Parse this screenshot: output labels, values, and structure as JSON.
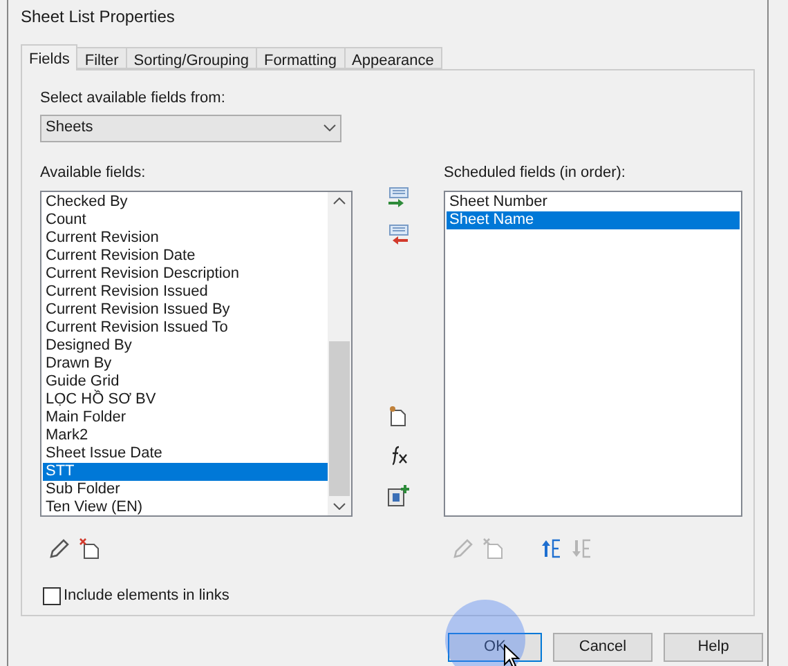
{
  "window": {
    "title": "Sheet List Properties"
  },
  "tabs": [
    {
      "label": "Fields",
      "selected": true
    },
    {
      "label": "Filter",
      "selected": false
    },
    {
      "label": "Sorting/Grouping",
      "selected": false
    },
    {
      "label": "Formatting",
      "selected": false
    },
    {
      "label": "Appearance",
      "selected": false
    }
  ],
  "source_label": "Select available fields from:",
  "source": {
    "value": "Sheets"
  },
  "available_label": "Available fields:",
  "available_fields": [
    {
      "label": "Checked By",
      "selected": false
    },
    {
      "label": "Count",
      "selected": false
    },
    {
      "label": "Current Revision",
      "selected": false
    },
    {
      "label": "Current Revision Date",
      "selected": false
    },
    {
      "label": "Current Revision Description",
      "selected": false
    },
    {
      "label": "Current Revision Issued",
      "selected": false
    },
    {
      "label": "Current Revision Issued By",
      "selected": false
    },
    {
      "label": "Current Revision Issued To",
      "selected": false
    },
    {
      "label": "Designed By",
      "selected": false
    },
    {
      "label": "Drawn By",
      "selected": false
    },
    {
      "label": "Guide Grid",
      "selected": false
    },
    {
      "label": "LỌC HỒ SƠ BV",
      "selected": false
    },
    {
      "label": "Main Folder",
      "selected": false
    },
    {
      "label": "Mark2",
      "selected": false
    },
    {
      "label": "Sheet Issue Date",
      "selected": false
    },
    {
      "label": "STT",
      "selected": true
    },
    {
      "label": "Sub Folder",
      "selected": false
    },
    {
      "label": "Ten View (EN)",
      "selected": false
    }
  ],
  "middle_actions": [
    {
      "kind": "add"
    },
    {
      "kind": "remove"
    },
    {
      "kind": "parameter"
    },
    {
      "kind": "formula"
    },
    {
      "kind": "combine"
    }
  ],
  "scheduled_label": "Scheduled fields (in order):",
  "scheduled_fields": [
    {
      "label": "Sheet Number",
      "selected": false
    },
    {
      "label": "Sheet Name",
      "selected": true
    }
  ],
  "available_actions": [
    {
      "kind": "edit",
      "disabled": false
    },
    {
      "kind": "delete",
      "disabled": false
    }
  ],
  "scheduled_actions": [
    {
      "kind": "edit",
      "disabled": true
    },
    {
      "kind": "delete",
      "disabled": true
    },
    {
      "kind": "move_up",
      "disabled": false
    },
    {
      "kind": "move_down",
      "disabled": true
    }
  ],
  "include_links": {
    "label": "Include elements in links",
    "checked": false
  },
  "buttons": [
    {
      "label": "OK",
      "default": true
    },
    {
      "label": "Cancel",
      "default": false
    },
    {
      "label": "Help",
      "default": false
    }
  ]
}
